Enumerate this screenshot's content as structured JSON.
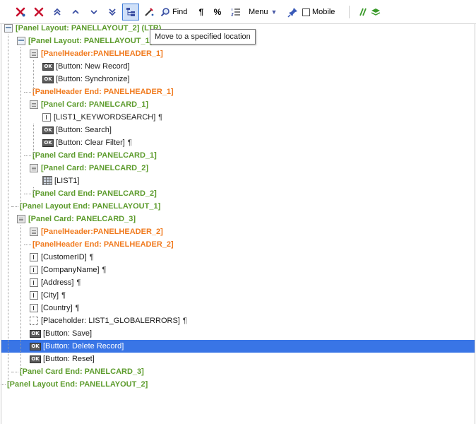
{
  "toolbar": {
    "find_label": "Find",
    "percent_label": "%",
    "menu_label": "Menu",
    "mobile_label": "Mobile",
    "mobile_checked": false
  },
  "tooltip": {
    "text": "Move to a specified location"
  },
  "tree": {
    "rows": [
      {
        "label": "[Panel Layout: PANELLAYOUT_2] (LTR)",
        "kind": "panel",
        "color": "green",
        "pilcrow": false
      },
      {
        "label": "[Panel Layout: PANELLAYOUT_1]",
        "kind": "panel",
        "color": "green",
        "pilcrow": false
      },
      {
        "label": "[PanelHeader:PANELHEADER_1]",
        "kind": "card",
        "color": "orange",
        "pilcrow": false
      },
      {
        "label": "[Button: New Record]",
        "kind": "button",
        "color": "black",
        "pilcrow": false
      },
      {
        "label": "[Button: Synchronize]",
        "kind": "button",
        "color": "black",
        "pilcrow": false
      },
      {
        "label": "[PanelHeader End: PANELHEADER_1]",
        "kind": "end",
        "color": "orange",
        "pilcrow": false
      },
      {
        "label": "[Panel Card: PANELCARD_1]",
        "kind": "card",
        "color": "green",
        "pilcrow": false
      },
      {
        "label": "[LIST1_KEYWORDSEARCH]",
        "kind": "field",
        "color": "black",
        "pilcrow": true
      },
      {
        "label": "[Button: Search]",
        "kind": "button",
        "color": "black",
        "pilcrow": false
      },
      {
        "label": "[Button: Clear Filter]",
        "kind": "button",
        "color": "black",
        "pilcrow": true
      },
      {
        "label": "[Panel Card End: PANELCARD_1]",
        "kind": "end",
        "color": "green",
        "pilcrow": false
      },
      {
        "label": "[Panel Card: PANELCARD_2]",
        "kind": "card",
        "color": "green",
        "pilcrow": false
      },
      {
        "label": "[LIST1]",
        "kind": "list",
        "color": "black",
        "pilcrow": false
      },
      {
        "label": "[Panel Card End: PANELCARD_2]",
        "kind": "end",
        "color": "green",
        "pilcrow": false
      },
      {
        "label": "[Panel Layout End: PANELLAYOUT_1]",
        "kind": "end",
        "color": "green",
        "pilcrow": false
      },
      {
        "label": "[Panel Card: PANELCARD_3]",
        "kind": "card",
        "color": "green",
        "pilcrow": false
      },
      {
        "label": "[PanelHeader:PANELHEADER_2]",
        "kind": "card",
        "color": "orange",
        "pilcrow": false
      },
      {
        "label": "[PanelHeader End: PANELHEADER_2]",
        "kind": "end",
        "color": "orange",
        "pilcrow": false
      },
      {
        "label": "[CustomerID]",
        "kind": "field",
        "color": "black",
        "pilcrow": true
      },
      {
        "label": "[CompanyName]",
        "kind": "field",
        "color": "black",
        "pilcrow": true
      },
      {
        "label": "[Address]",
        "kind": "field",
        "color": "black",
        "pilcrow": true
      },
      {
        "label": "[City]",
        "kind": "field",
        "color": "black",
        "pilcrow": true
      },
      {
        "label": "[Country]",
        "kind": "field",
        "color": "black",
        "pilcrow": true
      },
      {
        "label": "[Placeholder: LIST1_GLOBALERRORS]",
        "kind": "placeholder",
        "color": "black",
        "pilcrow": true
      },
      {
        "label": "[Button: Save]",
        "kind": "button",
        "color": "black",
        "pilcrow": false
      },
      {
        "label": "[Button: Delete Record]",
        "kind": "button",
        "color": "black",
        "pilcrow": false,
        "selected": true
      },
      {
        "label": "[Button: Reset]",
        "kind": "button",
        "color": "black",
        "pilcrow": false
      },
      {
        "label": "[Panel Card End: PANELCARD_3]",
        "kind": "end",
        "color": "green",
        "pilcrow": false
      },
      {
        "label": "[Panel Layout End: PANELLAYOUT_2]",
        "kind": "end",
        "color": "green",
        "pilcrow": false
      }
    ]
  },
  "colors": {
    "green": "#5c9b2c",
    "orange": "#f07a1e",
    "selection": "#3975e6",
    "active_button": "#cfe0f8"
  }
}
